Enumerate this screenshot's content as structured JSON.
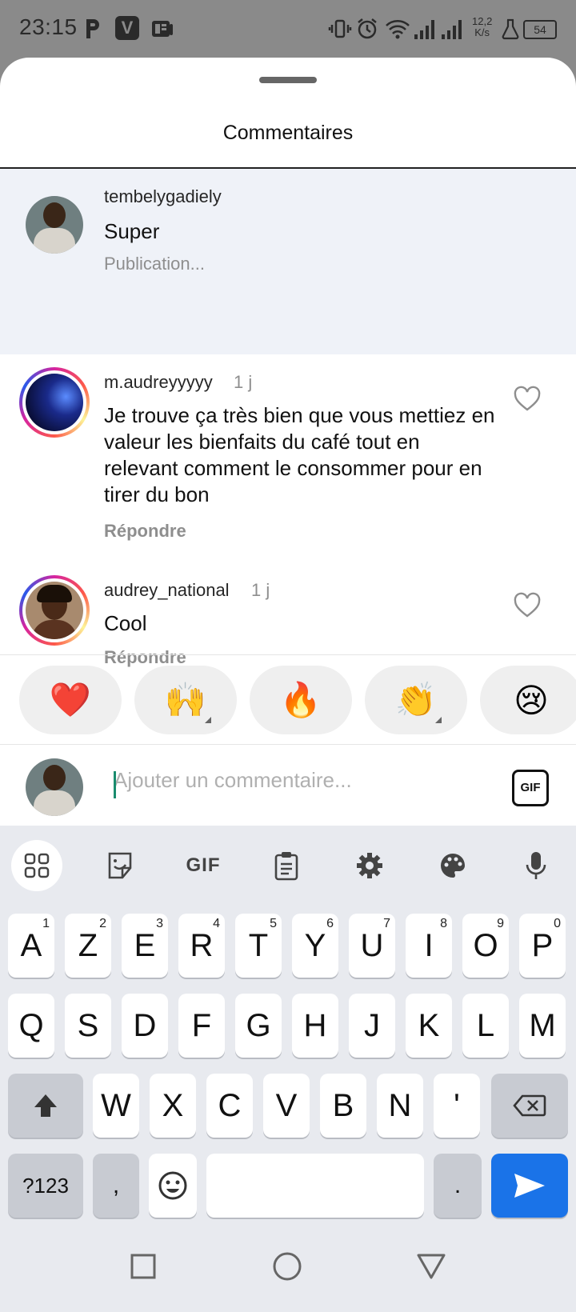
{
  "status_bar": {
    "time": "23:15",
    "net_speed_value": "12,2",
    "net_speed_unit": "K/s",
    "battery": "54"
  },
  "sheet": {
    "title": "Commentaires"
  },
  "comments": [
    {
      "username": "tembelygadiely",
      "time": "",
      "text": "Super",
      "meta": "Publication..."
    },
    {
      "username": "m.audreyyyyy",
      "time": "1 j",
      "text": "Je trouve ça très bien que vous mettiez en valeur les bienfaits du café tout en relevant comment le consommer pour en tirer du bon",
      "meta": "Répondre"
    },
    {
      "username": "audrey_national",
      "time": "1 j",
      "text": "Cool",
      "meta": "Répondre"
    }
  ],
  "reactions": [
    "❤️",
    "🙌",
    "🔥",
    "👏",
    "😢"
  ],
  "comment_input": {
    "placeholder": "Ajouter un commentaire...",
    "gif_label": "GIF"
  },
  "keyboard": {
    "toolbar": [
      "apps-grid-icon",
      "sticker-icon",
      "GIF",
      "clipboard-icon",
      "settings-icon",
      "palette-icon",
      "mic-icon"
    ],
    "toolbar_gif": "GIF",
    "row1": [
      {
        "k": "A",
        "h": "1"
      },
      {
        "k": "Z",
        "h": "2"
      },
      {
        "k": "E",
        "h": "3"
      },
      {
        "k": "R",
        "h": "4"
      },
      {
        "k": "T",
        "h": "5"
      },
      {
        "k": "Y",
        "h": "6"
      },
      {
        "k": "U",
        "h": "7"
      },
      {
        "k": "I",
        "h": "8"
      },
      {
        "k": "O",
        "h": "9"
      },
      {
        "k": "P",
        "h": "0"
      }
    ],
    "row2": [
      "Q",
      "S",
      "D",
      "F",
      "G",
      "H",
      "J",
      "K",
      "L",
      "M"
    ],
    "row3": [
      "W",
      "X",
      "C",
      "V",
      "B",
      "N",
      "'"
    ],
    "sym_label": "?123",
    "comma": ",",
    "period": "."
  },
  "colors": {
    "accent_blue": "#1a73e8",
    "highlight_bg": "#eff2f8",
    "heart_red": "#e0245e"
  }
}
